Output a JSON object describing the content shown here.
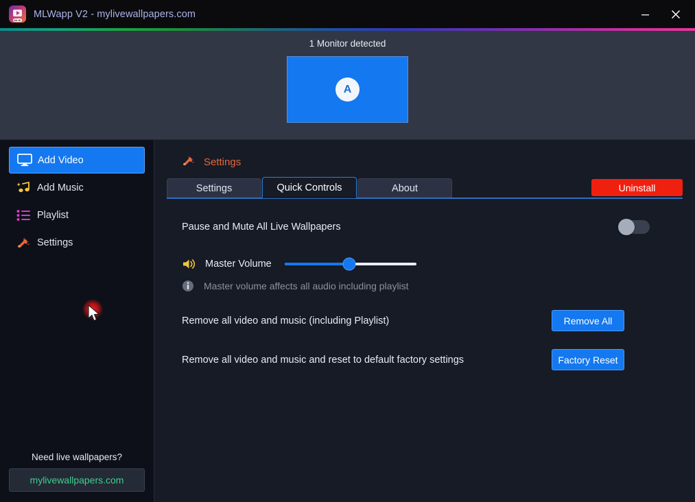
{
  "window": {
    "title": "MLWapp V2 - mylivewallpapers.com",
    "logo_icon": "mlwapp-logo-icon",
    "minimize_label": "Minimize",
    "close_label": "Close"
  },
  "monitor": {
    "detected_text": "1 Monitor detected",
    "display_letter": "A",
    "screen_color": "#1478f0"
  },
  "sidebar": {
    "items": [
      {
        "label": "Add Video",
        "icon": "monitor-icon",
        "active": true
      },
      {
        "label": "Add Music",
        "icon": "music-note-icon",
        "active": false
      },
      {
        "label": "Playlist",
        "icon": "list-icon",
        "active": false
      },
      {
        "label": "Settings",
        "icon": "tools-icon",
        "active": false
      }
    ],
    "footer": {
      "prompt": "Need live wallpapers?",
      "link_label": "mylivewallpapers.com",
      "link_color": "#3fcf8e"
    }
  },
  "panel": {
    "heading": "Settings",
    "heading_icon": "tools-icon",
    "heading_color": "#e8663a",
    "tabs": [
      {
        "label": "Settings",
        "active": false
      },
      {
        "label": "Quick Controls",
        "active": true
      },
      {
        "label": "About",
        "active": false
      }
    ],
    "uninstall_label": "Uninstall",
    "uninstall_color": "#f02010"
  },
  "quick_controls": {
    "pause_mute": {
      "label": "Pause and Mute All Live Wallpapers",
      "toggle_state": "off"
    },
    "master_volume": {
      "label": "Master Volume",
      "icon": "speaker-icon",
      "value_percent": 49,
      "hint_icon": "info-icon",
      "hint": "Master volume affects all audio including playlist"
    },
    "remove_all": {
      "label": "Remove all video and music (including Playlist)",
      "button_label": "Remove All"
    },
    "factory_reset": {
      "label": "Remove all video and music and reset to default factory settings",
      "button_label": "Factory Reset"
    }
  }
}
